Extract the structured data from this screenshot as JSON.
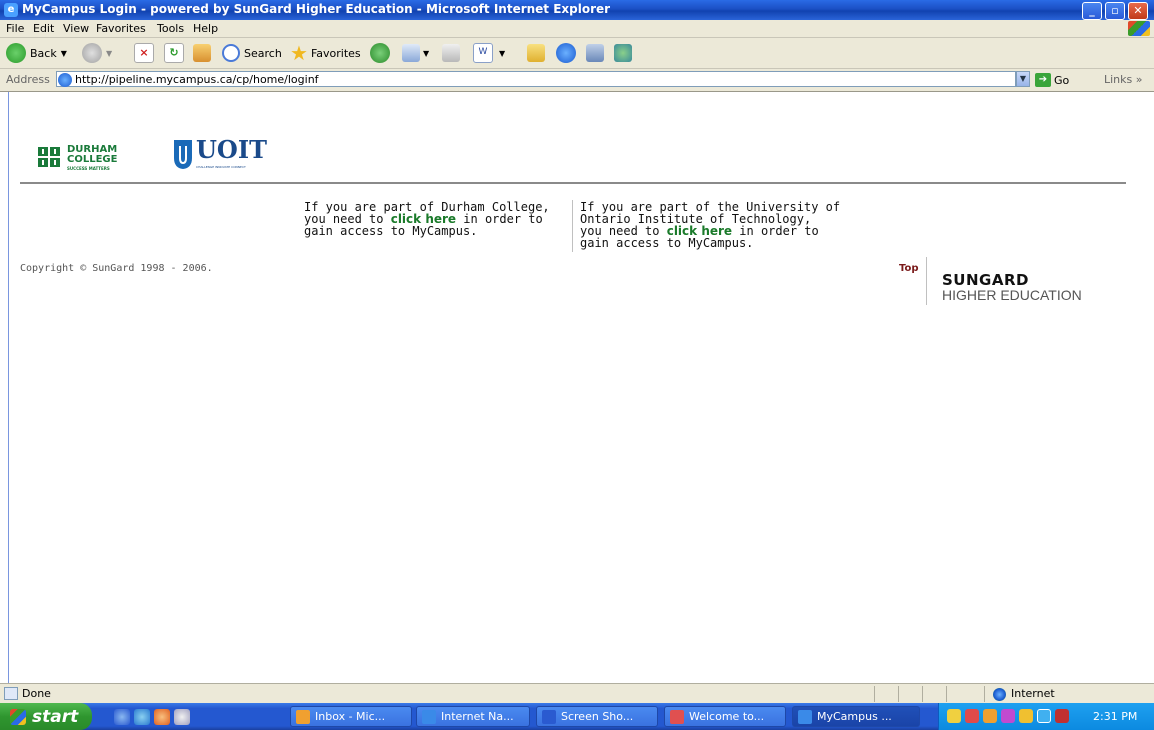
{
  "window": {
    "title": "MyCampus Login - powered by SunGard Higher Education - Microsoft Internet Explorer",
    "minimize": "_",
    "maximize": "▫",
    "close": "✕"
  },
  "menu": [
    "File",
    "Edit",
    "View",
    "Favorites",
    "Tools",
    "Help"
  ],
  "toolbar": {
    "back_label": "Back",
    "search_label": "Search",
    "favorites_label": "Favorites"
  },
  "address_bar": {
    "label": "Address",
    "url": "http://pipeline.mycampus.ca/cp/home/loginf",
    "go_label": "Go",
    "links_label": "Links"
  },
  "page": {
    "durham_logo_line1": "DURHAM",
    "durham_logo_line2": "COLLEGE",
    "durham_logo_tagline": "SUCCESS MATTERS",
    "uoit_logo_text": "UOIT",
    "uoit_logo_tagline": "CHALLENGE INNOVATE CONNECT",
    "durham_msg": {
      "line1": "If you are part of Durham College,",
      "line2_pre": "you need to ",
      "link": "click here",
      "line2_post": " in order to",
      "line3": "gain access to MyCampus."
    },
    "uoit_msg": {
      "line1": "If you are part of the University of",
      "line2": "Ontario Institute of Technology,",
      "line3_pre": "you need to ",
      "link": "click here",
      "line3_post": " in order to",
      "line4": "gain access to MyCampus."
    },
    "copyright": "Copyright © SunGard 1998 - 2006.",
    "top_link": "Top",
    "sungard_line1": "SUNGARD",
    "sungard_line2": "HIGHER EDUCATION"
  },
  "status_bar": {
    "text": "Done",
    "zone": "Internet"
  },
  "taskbar": {
    "start_label": "start",
    "tasks": [
      {
        "label": "Inbox - Mic...",
        "color": "#f0a030"
      },
      {
        "label": "Internet Na...",
        "color": "#3a8ae8"
      },
      {
        "label": "Screen Sho...",
        "color": "#2a5ad0"
      },
      {
        "label": "Welcome to...",
        "color": "#e05050"
      },
      {
        "label": "MyCampus ...",
        "color": "#3a8ae8"
      }
    ],
    "clock": "2:31 PM"
  }
}
